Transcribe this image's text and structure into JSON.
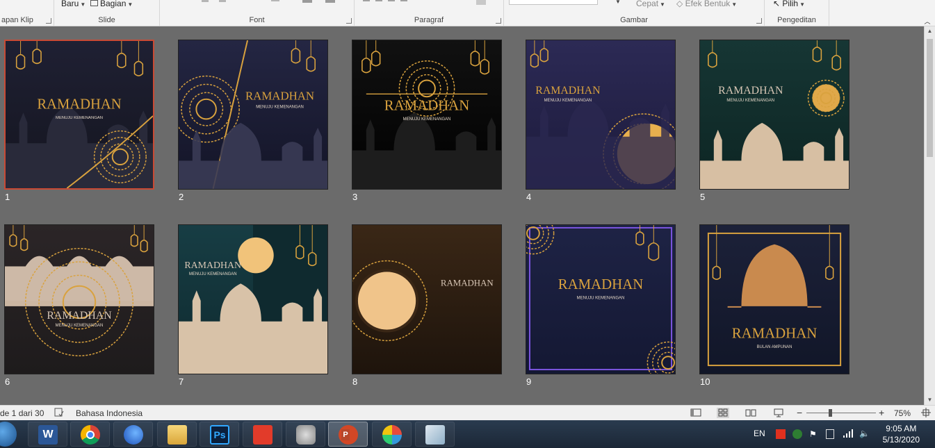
{
  "ribbon": {
    "groups": [
      {
        "label": "apan Klip"
      },
      {
        "label": "Slide"
      },
      {
        "label": "Font"
      },
      {
        "label": "Paragraf"
      },
      {
        "label": "Gambar"
      },
      {
        "label": "Pengeditan"
      }
    ],
    "buttons": {
      "new_slide": "Baru",
      "section": "Bagian",
      "transition_speed": "Cepat",
      "shape_effects": "Efek Bentuk",
      "select": "Pilih"
    }
  },
  "slides": [
    {
      "number": "1",
      "title": "RAMADHAN",
      "subtitle": "MENUJU KEMENANGAN",
      "selected": true
    },
    {
      "number": "2",
      "title": "RAMADHAN",
      "subtitle": "MENUJU KEMENANGAN"
    },
    {
      "number": "3",
      "title": "RAMADHAN",
      "subtitle": "MENUJU KEMENANGAN"
    },
    {
      "number": "4",
      "title": "RAMADHAN",
      "subtitle": "MENUJU KEMENANGAN"
    },
    {
      "number": "5",
      "title": "RAMADHAN",
      "subtitle": "MENUJU KEMENANGAN"
    },
    {
      "number": "6",
      "title": "RAMADHAN",
      "subtitle": "MENUJU KEMENANGAN"
    },
    {
      "number": "7",
      "title": "RAMADHAN",
      "subtitle": "MENUJU KEMENANGAN"
    },
    {
      "number": "8",
      "title": "RAMADHAN",
      "subtitle": ""
    },
    {
      "number": "9",
      "title": "RAMADHAN",
      "subtitle": "MENUJU KEMENANGAN"
    },
    {
      "number": "10",
      "title": "RAMADHAN",
      "subtitle": "BULAN AMPUNAN"
    }
  ],
  "statusbar": {
    "slide_count": "de 1 dari 30",
    "language": "Bahasa Indonesia",
    "zoom_minus": "−",
    "zoom_plus": "+",
    "zoom": "75%"
  },
  "taskbar": {
    "apps": [
      "word-icon",
      "chrome-icon",
      "firefox-icon",
      "file-explorer-icon",
      "photoshop-icon",
      "acrobat-icon",
      "camera-icon",
      "powerpoint-icon",
      "paint-icon",
      "notepad-icon"
    ],
    "photoshop_label": "Ps",
    "word_label": "W",
    "lang": "EN",
    "time": "9:05 AM",
    "date": "5/13/2020"
  },
  "colors": {
    "gold": "#d9a23e",
    "selected_border": "#c94a34",
    "sorter_bg": "#6b6b6b"
  }
}
